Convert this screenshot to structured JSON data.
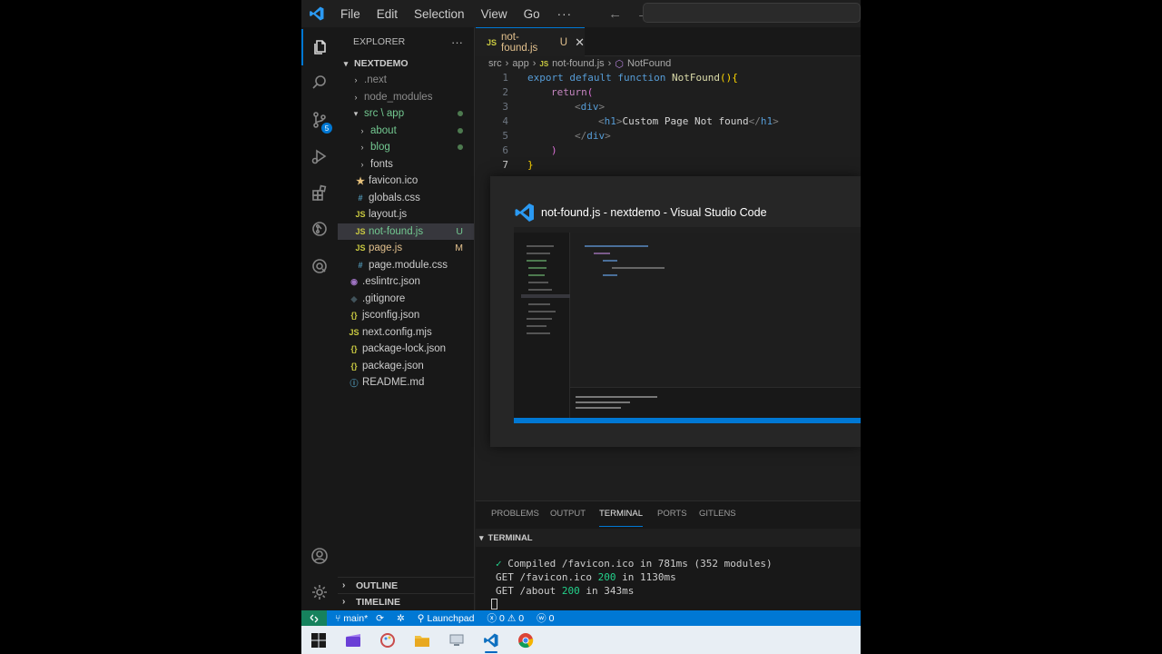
{
  "titlebar": {
    "menus": [
      "File",
      "Edit",
      "Selection",
      "View",
      "Go"
    ],
    "more": "···",
    "back": "←",
    "forward": "→"
  },
  "activity_bar": {
    "source_control_badge": "5"
  },
  "explorer": {
    "title": "EXPLORER",
    "more": "···",
    "workspace": "NEXTDEMO",
    "items": [
      {
        "label": ".next",
        "status": ""
      },
      {
        "label": "node_modules",
        "status": ""
      },
      {
        "label": "src \\ app",
        "status": ""
      },
      {
        "label": "about",
        "status": ""
      },
      {
        "label": "blog",
        "status": ""
      },
      {
        "label": "fonts",
        "status": ""
      },
      {
        "label": "favicon.ico",
        "status": ""
      },
      {
        "label": "globals.css",
        "status": ""
      },
      {
        "label": "layout.js",
        "status": ""
      },
      {
        "label": "not-found.js",
        "status": "U"
      },
      {
        "label": "page.js",
        "status": "M"
      },
      {
        "label": "page.module.css",
        "status": ""
      },
      {
        "label": ".eslintrc.json",
        "status": ""
      },
      {
        "label": ".gitignore",
        "status": ""
      },
      {
        "label": "jsconfig.json",
        "status": ""
      },
      {
        "label": "next.config.mjs",
        "status": ""
      },
      {
        "label": "package-lock.json",
        "status": ""
      },
      {
        "label": "package.json",
        "status": ""
      },
      {
        "label": "README.md",
        "status": ""
      }
    ],
    "outline": "OUTLINE",
    "timeline": "TIMELINE"
  },
  "editor": {
    "tab": {
      "icon": "JS",
      "label": "not-found.js",
      "status": "U",
      "close": "✕"
    },
    "breadcrumb": [
      "src",
      "app",
      "not-found.js",
      "NotFound"
    ],
    "line_numbers": [
      "1",
      "2",
      "3",
      "4",
      "5",
      "6",
      "7"
    ],
    "code": {
      "l1": {
        "kw1": "export",
        "kw2": "default",
        "kw3": "function",
        "fn": "NotFound",
        "paren": "()",
        "brace": "{"
      },
      "l2": {
        "kw": "return",
        "paren": "("
      },
      "l3": {
        "open": "<",
        "tag": "div",
        "close": ">"
      },
      "l4": {
        "open": "<",
        "tag": "h1",
        "close": ">",
        "text": "Custom Page Not found",
        "end_open": "</",
        "end_tag": "h1",
        "end_close": ">"
      },
      "l5": {
        "open": "</",
        "tag": "div",
        "close": ">"
      },
      "l6": {
        "paren": ")"
      },
      "l7": {
        "brace": "}"
      }
    }
  },
  "preview": {
    "title": "not-found.js - nextdemo - Visual Studio Code"
  },
  "panel": {
    "tabs": [
      "PROBLEMS",
      "OUTPUT",
      "TERMINAL",
      "PORTS",
      "GITLENS"
    ],
    "active_tab": "TERMINAL",
    "terminal_header": "TERMINAL",
    "lines": [
      {
        "check": "✓",
        "text": " Compiled /favicon.ico in 781ms (352 modules)"
      },
      {
        "pre": "GET /favicon.ico ",
        "code": "200",
        "post": " in 1130ms"
      },
      {
        "pre": "GET /about ",
        "code": "200",
        "post": " in 343ms"
      }
    ]
  },
  "status_bar": {
    "branch": "main*",
    "launchpad": "Launchpad",
    "errors": "0",
    "warnings": "0",
    "ports": "0"
  },
  "colors": {
    "accent": "#0078d4",
    "remote": "#16825d",
    "editor_bg": "#1e1e1e",
    "sidebar_bg": "#181818"
  }
}
